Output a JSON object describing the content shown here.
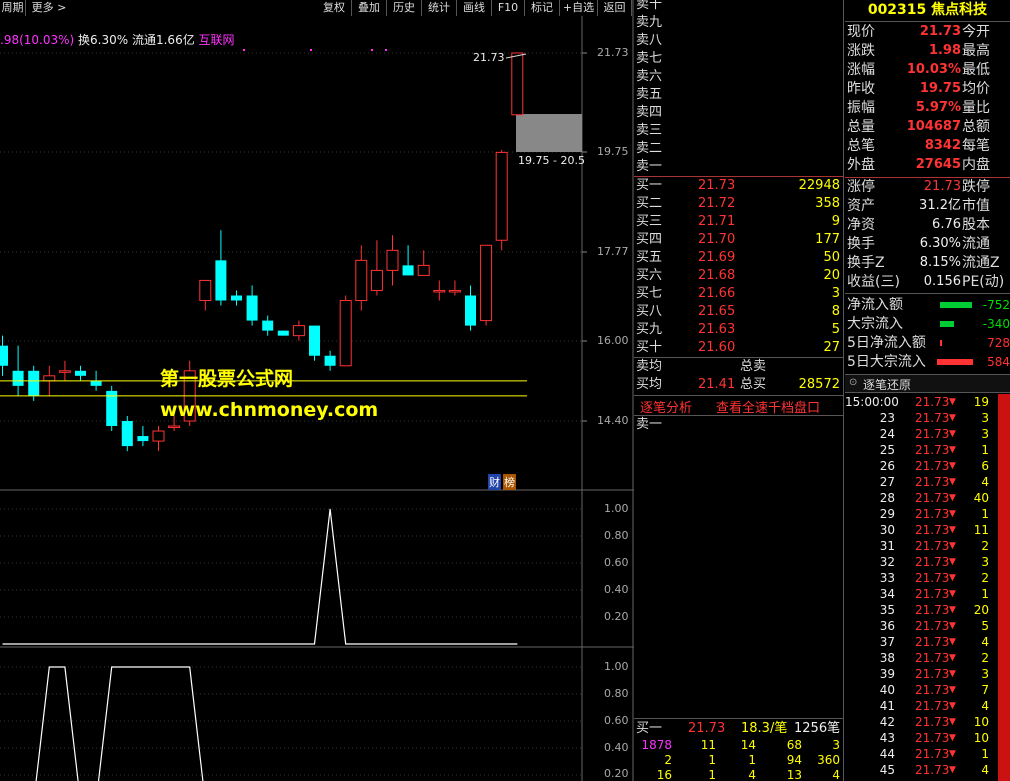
{
  "toolbar": {
    "period": "周期",
    "more": "更多",
    "buttons": [
      "复权",
      "叠加",
      "历史",
      "统计",
      "画线",
      "F10",
      "标记",
      "+自选",
      "返回"
    ]
  },
  "info_line": {
    "change": ".98(10.03%)",
    "turnover": "换6.30%",
    "float": "流通1.66亿",
    "sector": "互联网"
  },
  "chart_labels": {
    "high_label": "21.73",
    "range_label": "19.75 - 20.5",
    "watermark_name": "第一股票公式网",
    "watermark_url": "www.chnmoney.com",
    "badge1": "财",
    "badge2": "榜"
  },
  "axes": {
    "main": [
      "21.73",
      "19.75",
      "17.77",
      "16.00",
      "14.40"
    ],
    "ind1": [
      "1.00",
      "0.80",
      "0.60",
      "0.40",
      "0.20"
    ],
    "ind2": [
      "1.00",
      "0.80",
      "0.60",
      "0.40",
      "0.20"
    ]
  },
  "chart_data": [
    {
      "type": "candlestick",
      "ylim": [
        13.6,
        22.4
      ],
      "candles": [
        {
          "o": 15.9,
          "h": 16.1,
          "l": 15.3,
          "c": 15.5
        },
        {
          "o": 15.4,
          "h": 15.9,
          "l": 14.9,
          "c": 15.1
        },
        {
          "o": 15.4,
          "h": 15.5,
          "l": 14.8,
          "c": 14.9
        },
        {
          "o": 15.2,
          "h": 15.5,
          "l": 14.9,
          "c": 15.3
        },
        {
          "o": 15.4,
          "h": 15.6,
          "l": 15.2,
          "c": 15.4
        },
        {
          "o": 15.4,
          "h": 15.5,
          "l": 15.2,
          "c": 15.3
        },
        {
          "o": 15.2,
          "h": 15.4,
          "l": 15.0,
          "c": 15.1
        },
        {
          "o": 15.0,
          "h": 15.1,
          "l": 14.2,
          "c": 14.3
        },
        {
          "o": 14.4,
          "h": 14.5,
          "l": 13.8,
          "c": 13.9
        },
        {
          "o": 14.1,
          "h": 14.3,
          "l": 13.9,
          "c": 14.0
        },
        {
          "o": 14.0,
          "h": 14.3,
          "l": 13.8,
          "c": 14.2
        },
        {
          "o": 14.3,
          "h": 14.5,
          "l": 14.2,
          "c": 14.3
        },
        {
          "o": 14.4,
          "h": 15.6,
          "l": 14.3,
          "c": 15.4
        },
        {
          "o": 16.8,
          "h": 17.2,
          "l": 16.6,
          "c": 17.2
        },
        {
          "o": 17.6,
          "h": 18.2,
          "l": 16.7,
          "c": 16.8
        },
        {
          "o": 16.9,
          "h": 17.0,
          "l": 16.7,
          "c": 16.8
        },
        {
          "o": 16.9,
          "h": 17.1,
          "l": 16.3,
          "c": 16.4
        },
        {
          "o": 16.4,
          "h": 16.5,
          "l": 16.1,
          "c": 16.2
        },
        {
          "o": 16.2,
          "h": 16.2,
          "l": 16.1,
          "c": 16.1
        },
        {
          "o": 16.1,
          "h": 16.4,
          "l": 16.0,
          "c": 16.3
        },
        {
          "o": 16.3,
          "h": 16.3,
          "l": 15.6,
          "c": 15.7
        },
        {
          "o": 15.7,
          "h": 15.8,
          "l": 15.4,
          "c": 15.5
        },
        {
          "o": 15.5,
          "h": 16.9,
          "l": 15.5,
          "c": 16.8
        },
        {
          "o": 16.8,
          "h": 17.9,
          "l": 16.6,
          "c": 17.6
        },
        {
          "o": 17.0,
          "h": 18.0,
          "l": 16.9,
          "c": 17.4
        },
        {
          "o": 17.4,
          "h": 18.1,
          "l": 17.1,
          "c": 17.8
        },
        {
          "o": 17.5,
          "h": 17.9,
          "l": 17.3,
          "c": 17.3
        },
        {
          "o": 17.3,
          "h": 17.8,
          "l": 17.3,
          "c": 17.5
        },
        {
          "o": 17.0,
          "h": 17.2,
          "l": 16.8,
          "c": 17.0
        },
        {
          "o": 17.0,
          "h": 17.2,
          "l": 16.9,
          "c": 17.0
        },
        {
          "o": 16.9,
          "h": 17.1,
          "l": 16.2,
          "c": 16.3
        },
        {
          "o": 16.4,
          "h": 17.9,
          "l": 16.3,
          "c": 17.9
        },
        {
          "o": 18.0,
          "h": 19.8,
          "l": 17.8,
          "c": 19.75
        },
        {
          "o": 20.5,
          "h": 21.73,
          "l": 20.5,
          "c": 21.73
        }
      ],
      "lines": [
        15.2,
        14.9
      ]
    },
    {
      "type": "line",
      "ylim": [
        0,
        1.1
      ],
      "values": [
        0,
        0,
        0,
        0,
        0,
        0,
        0,
        0,
        0,
        0,
        0,
        0,
        0,
        0,
        0,
        0,
        0,
        0,
        0,
        0,
        0,
        1,
        0,
        0,
        0,
        0,
        0,
        0,
        0,
        0,
        0,
        0,
        0,
        0
      ]
    },
    {
      "type": "line",
      "ylim": [
        0,
        1.1
      ],
      "values": [
        0,
        0,
        0,
        1,
        1,
        0,
        0,
        1,
        1,
        1,
        1,
        1,
        1,
        0,
        0,
        0,
        0,
        0,
        0,
        0,
        0,
        0,
        0,
        0,
        0,
        0,
        0,
        0,
        0,
        0,
        0,
        0,
        0,
        0
      ]
    }
  ],
  "quote": {
    "code": "002315",
    "name": "焦点科技",
    "sell_labels": [
      "卖十",
      "卖九",
      "卖八",
      "卖七",
      "卖六",
      "卖五",
      "卖四",
      "卖三",
      "卖二",
      "卖一"
    ],
    "buy": [
      {
        "label": "买一",
        "price": "21.73",
        "vol": "22948"
      },
      {
        "label": "买二",
        "price": "21.72",
        "vol": "358"
      },
      {
        "label": "买三",
        "price": "21.71",
        "vol": "9"
      },
      {
        "label": "买四",
        "price": "21.70",
        "vol": "177"
      },
      {
        "label": "买五",
        "price": "21.69",
        "vol": "50"
      },
      {
        "label": "买六",
        "price": "21.68",
        "vol": "20"
      },
      {
        "label": "买七",
        "price": "21.66",
        "vol": "3"
      },
      {
        "label": "买八",
        "price": "21.65",
        "vol": "8"
      },
      {
        "label": "买九",
        "price": "21.63",
        "vol": "5"
      },
      {
        "label": "买十",
        "price": "21.60",
        "vol": "27"
      }
    ],
    "sell_avg_label": "卖均",
    "sell_total_label": "总卖",
    "buy_avg_label": "买均",
    "buy_avg": "21.41",
    "buy_total_label": "总买",
    "buy_total": "28572",
    "tab1": "逐笔分析",
    "tab2": "查看全速千档盘口",
    "sell1_row": "卖一",
    "bottom_buy1_label": "买一",
    "bottom_buy1_price": "21.73",
    "bottom_avg": "18.3/笔",
    "bottom_count": "1256笔",
    "bottom_rows": [
      [
        "1878",
        "11",
        "14",
        "68",
        "3"
      ],
      [
        "2",
        "1",
        "1",
        "94",
        "360"
      ],
      [
        "16",
        "1",
        "4",
        "13",
        "4"
      ]
    ]
  },
  "stats": [
    {
      "l1": "现价",
      "v1": "21.73",
      "l2": "今开"
    },
    {
      "l1": "涨跌",
      "v1": "1.98",
      "l2": "最高"
    },
    {
      "l1": "涨幅",
      "v1": "10.03%",
      "l2": "最低"
    },
    {
      "l1": "昨收",
      "v1": "19.75",
      "l2": "均价"
    },
    {
      "l1": "振幅",
      "v1": "5.97%",
      "l2": "量比"
    },
    {
      "l1": "总量",
      "v1": "104687",
      "l2": "总额"
    },
    {
      "l1": "总笔",
      "v1": "8342",
      "l2": "每笔"
    },
    {
      "l1": "外盘",
      "v1": "27645",
      "l2": "内盘"
    }
  ],
  "stats2": [
    {
      "l1": "涨停",
      "v1": "21.73",
      "l2": "跌停"
    },
    {
      "l1": "资产",
      "v1": "31.2亿",
      "l2": "市值"
    },
    {
      "l1": "净资",
      "v1": "6.76",
      "l2": "股本"
    },
    {
      "l1": "换手",
      "v1": "6.30%",
      "l2": "流通"
    },
    {
      "l1": "换手Z",
      "v1": "8.15%",
      "l2": "流通Z"
    },
    {
      "l1": "收益(三)",
      "v1": "0.156",
      "l2": "PE(动)"
    }
  ],
  "flows": [
    {
      "label": "净流入额",
      "value": "-752"
    },
    {
      "label": "大宗流入",
      "value": "-340"
    },
    {
      "label": "5日净流入额",
      "value": "728"
    },
    {
      "label": "5日大宗流入",
      "value": "584"
    }
  ],
  "ticks_header": "逐笔还原",
  "ticks": [
    {
      "t": "15:00:00",
      "p": "21.73",
      "v": "19"
    },
    {
      "t": "23",
      "p": "21.73",
      "v": "3"
    },
    {
      "t": "24",
      "p": "21.73",
      "v": "3"
    },
    {
      "t": "25",
      "p": "21.73",
      "v": "1"
    },
    {
      "t": "26",
      "p": "21.73",
      "v": "6"
    },
    {
      "t": "27",
      "p": "21.73",
      "v": "4"
    },
    {
      "t": "28",
      "p": "21.73",
      "v": "40"
    },
    {
      "t": "29",
      "p": "21.73",
      "v": "1"
    },
    {
      "t": "30",
      "p": "21.73",
      "v": "11"
    },
    {
      "t": "31",
      "p": "21.73",
      "v": "2"
    },
    {
      "t": "32",
      "p": "21.73",
      "v": "3"
    },
    {
      "t": "33",
      "p": "21.73",
      "v": "2"
    },
    {
      "t": "34",
      "p": "21.73",
      "v": "1"
    },
    {
      "t": "35",
      "p": "21.73",
      "v": "20"
    },
    {
      "t": "36",
      "p": "21.73",
      "v": "5"
    },
    {
      "t": "37",
      "p": "21.73",
      "v": "4"
    },
    {
      "t": "38",
      "p": "21.73",
      "v": "2"
    },
    {
      "t": "39",
      "p": "21.73",
      "v": "3"
    },
    {
      "t": "40",
      "p": "21.73",
      "v": "7"
    },
    {
      "t": "41",
      "p": "21.73",
      "v": "4"
    },
    {
      "t": "42",
      "p": "21.73",
      "v": "10"
    },
    {
      "t": "43",
      "p": "21.73",
      "v": "10"
    },
    {
      "t": "44",
      "p": "21.73",
      "v": "1"
    },
    {
      "t": "45",
      "p": "21.73",
      "v": "4"
    }
  ],
  "colors": {
    "up": "#ff3333",
    "down": "#00ffff",
    "accent": "#ffff00"
  }
}
